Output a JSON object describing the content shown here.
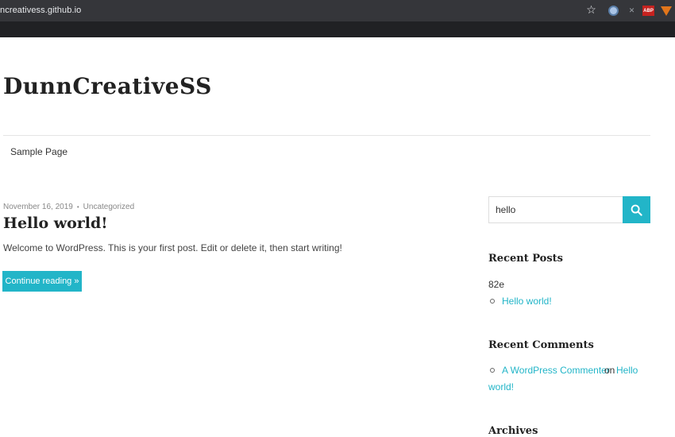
{
  "browser": {
    "url": "ncreativess.github.io",
    "icons": [
      "star-icon",
      "extension-icon",
      "extension-close-icon",
      "adblock-icon",
      "metamask-icon"
    ],
    "adblock_label": "ABP",
    "star_glyph": "☆",
    "ext2_glyph": "✕"
  },
  "site": {
    "title": "DunnCreativeSS",
    "nav": [
      "Sample Page"
    ]
  },
  "post": {
    "date": "November 16, 2019",
    "separator": "•",
    "category": "Uncategorized",
    "title": "Hello world!",
    "excerpt": "Welcome to WordPress. This is your first post. Edit or delete it, then start writing!",
    "continue_label": "Continue reading »"
  },
  "sidebar": {
    "search": {
      "value": "hello",
      "icon": "search-icon"
    },
    "recent_posts": {
      "title": "Recent Posts",
      "stray_text": "82e",
      "items": [
        "Hello world!"
      ]
    },
    "recent_comments": {
      "title": "Recent Comments",
      "author": "A WordPress Commenter",
      "on": "on",
      "post_part1": "Hello",
      "post_part2": "world!"
    },
    "archives": {
      "title": "Archives"
    }
  },
  "colors": {
    "accent": "#22b5c8",
    "chrome": "#202124"
  }
}
